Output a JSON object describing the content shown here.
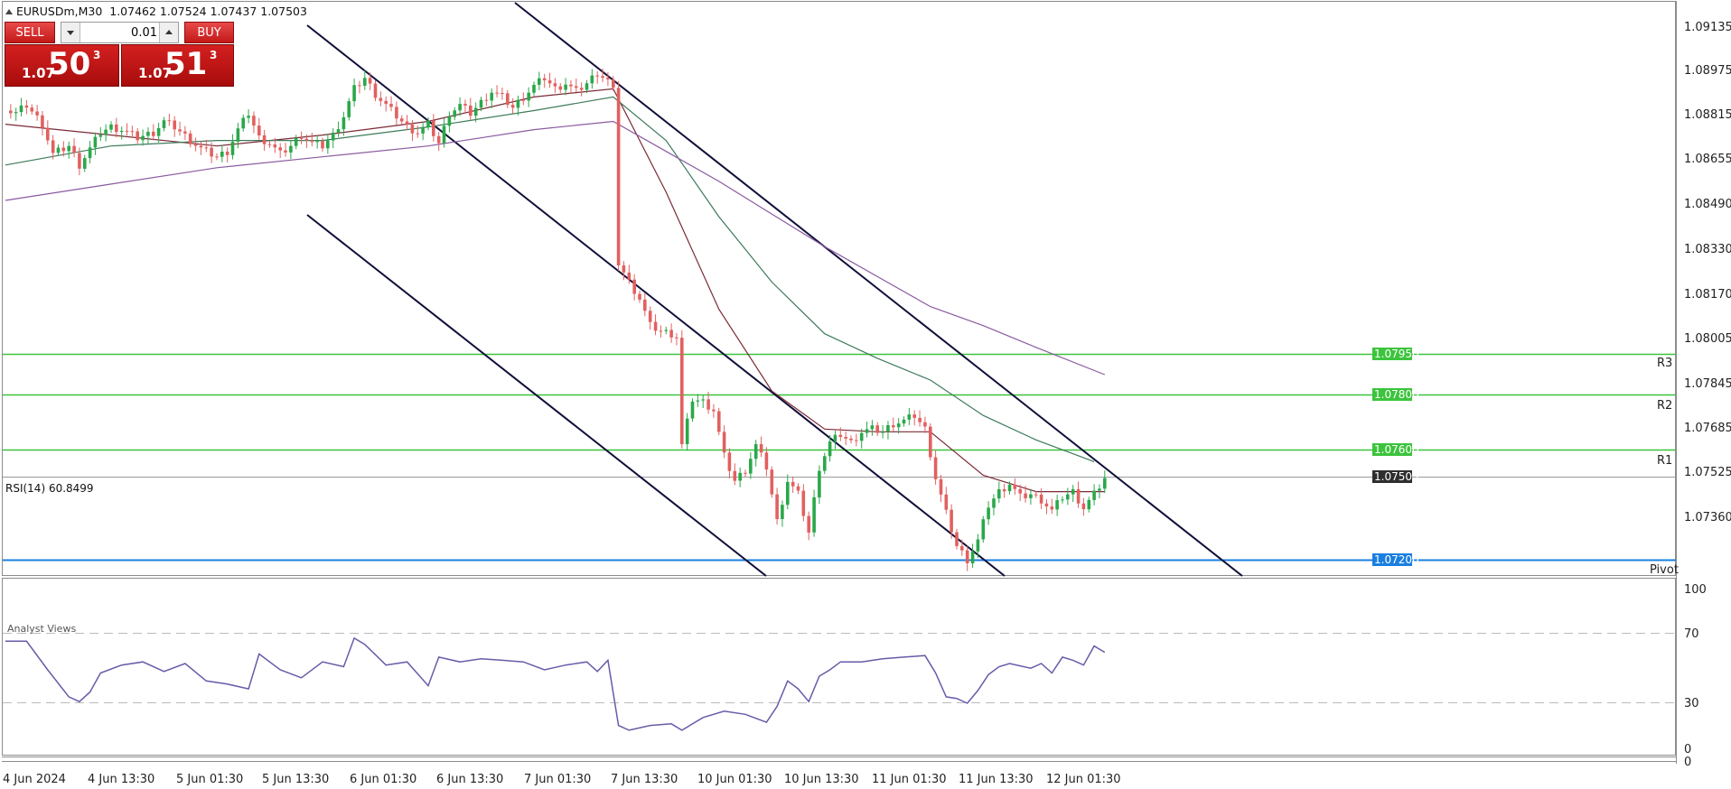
{
  "header": {
    "symbol_title": "EURUSDm,M30",
    "ohlc": "1.07462 1.07524 1.07437 1.07503"
  },
  "trade_panel": {
    "sell_label": "SELL",
    "buy_label": "BUY",
    "lot_value": "0.01",
    "sell_quote": {
      "prefix": "1.07",
      "big": "50",
      "sup": "3"
    },
    "buy_quote": {
      "prefix": "1.07",
      "big": "51",
      "sup": "3"
    }
  },
  "price_axis": {
    "ticks": [
      "1.09135",
      "1.08975",
      "1.08815",
      "1.08655",
      "1.08490",
      "1.08330",
      "1.08170",
      "1.08005",
      "1.07845",
      "1.07685",
      "1.07525",
      "1.07360"
    ],
    "tagged_levels": [
      {
        "label": "1.07950",
        "color": "#3cc43c",
        "kind": "R3"
      },
      {
        "label": "1.07800",
        "color": "#3cc43c",
        "kind": "R2"
      },
      {
        "label": "1.07600",
        "color": "#3cc43c",
        "kind": "R1"
      },
      {
        "label": "1.07503",
        "color": "#2e2e2e",
        "kind": "current"
      },
      {
        "label": "1.07200",
        "color": "#1a7fe0",
        "kind": "Pivot"
      }
    ],
    "level_markers": [
      "R3",
      "R2",
      "R1",
      "Pivot"
    ]
  },
  "rsi": {
    "label": "RSI(14) 60.8499",
    "ticks": [
      "100",
      "70",
      "30",
      "0"
    ]
  },
  "time_axis": {
    "labels": [
      "4 Jun 2024",
      "4 Jun 13:30",
      "5 Jun 01:30",
      "5 Jun 13:30",
      "6 Jun 01:30",
      "6 Jun 13:30",
      "7 Jun 01:30",
      "7 Jun 13:30",
      "10 Jun 01:30",
      "10 Jun 13:30",
      "11 Jun 01:30",
      "11 Jun 13:30",
      "12 Jun 01:30"
    ]
  },
  "bottom_panel": {
    "label": "Analyst Views",
    "scale_zero": "0"
  },
  "colors": {
    "bull": "#2aa84a",
    "bear": "#e26060",
    "ma_fast": "#7a2a36",
    "ma_mid": "#3e7a5a",
    "ma_slow": "#8a5aa0",
    "channel": "#10103a",
    "rsi": "#6a5aa8"
  },
  "chart_data": {
    "type": "candlestick",
    "price_range": [
      1.0716,
      1.0922
    ],
    "close_series": [
      [
        0,
        1.0885
      ],
      [
        2,
        1.0884
      ],
      [
        4,
        1.0887
      ],
      [
        7,
        1.088
      ],
      [
        9,
        1.0869
      ],
      [
        12,
        1.0872
      ],
      [
        14,
        1.0865
      ],
      [
        16,
        1.0871
      ],
      [
        18,
        1.0877
      ],
      [
        20,
        1.0879
      ],
      [
        22,
        1.0878
      ],
      [
        25,
        1.0875
      ],
      [
        28,
        1.0877
      ],
      [
        30,
        1.0881
      ],
      [
        32,
        1.0879
      ],
      [
        35,
        1.0874
      ],
      [
        37,
        1.0871
      ],
      [
        40,
        1.0868
      ],
      [
        42,
        1.087
      ],
      [
        44,
        1.0878
      ],
      [
        46,
        1.0884
      ],
      [
        48,
        1.0875
      ],
      [
        50,
        1.0873
      ],
      [
        52,
        1.0869
      ],
      [
        54,
        1.0872
      ],
      [
        56,
        1.0876
      ],
      [
        58,
        1.0873
      ],
      [
        60,
        1.0872
      ],
      [
        62,
        1.0876
      ],
      [
        64,
        1.0883
      ],
      [
        66,
        1.0893
      ],
      [
        68,
        1.0897
      ],
      [
        70,
        1.0891
      ],
      [
        72,
        1.0887
      ],
      [
        74,
        1.0883
      ],
      [
        76,
        1.0879
      ],
      [
        78,
        1.0877
      ],
      [
        80,
        1.088
      ],
      [
        82,
        1.0873
      ],
      [
        84,
        1.0884
      ],
      [
        86,
        1.0887
      ],
      [
        88,
        1.0884
      ],
      [
        90,
        1.0888
      ],
      [
        92,
        1.0892
      ],
      [
        94,
        1.089
      ],
      [
        96,
        1.0886
      ],
      [
        98,
        1.089
      ],
      [
        100,
        1.0894
      ],
      [
        102,
        1.0897
      ],
      [
        104,
        1.0893
      ],
      [
        106,
        1.0895
      ],
      [
        108,
        1.0892
      ],
      [
        110,
        1.0895
      ],
      [
        112,
        1.0899
      ],
      [
        114,
        1.0896
      ],
      [
        115,
        1.0892
      ],
      [
        116,
        1.0829
      ],
      [
        118,
        1.0822
      ],
      [
        120,
        1.0816
      ],
      [
        122,
        1.0806
      ],
      [
        124,
        1.0804
      ],
      [
        126,
        1.0803
      ],
      [
        127,
        1.0802
      ],
      [
        128,
        1.0762
      ],
      [
        130,
        1.0779
      ],
      [
        132,
        1.0778
      ],
      [
        134,
        1.0775
      ],
      [
        136,
        1.0758
      ],
      [
        138,
        1.0749
      ],
      [
        140,
        1.0753
      ],
      [
        142,
        1.0762
      ],
      [
        144,
        1.0754
      ],
      [
        146,
        1.0734
      ],
      [
        148,
        1.0749
      ],
      [
        150,
        1.0744
      ],
      [
        152,
        1.073
      ],
      [
        154,
        1.0754
      ],
      [
        156,
        1.0763
      ],
      [
        158,
        1.0766
      ],
      [
        160,
        1.0763
      ],
      [
        162,
        1.0767
      ],
      [
        164,
        1.0768
      ],
      [
        166,
        1.0767
      ],
      [
        168,
        1.077
      ],
      [
        170,
        1.0771
      ],
      [
        172,
        1.0773
      ],
      [
        174,
        1.0768
      ],
      [
        176,
        1.075
      ],
      [
        178,
        1.0737
      ],
      [
        180,
        1.0725
      ],
      [
        182,
        1.072
      ],
      [
        184,
        1.0727
      ],
      [
        186,
        1.074
      ],
      [
        188,
        1.0745
      ],
      [
        190,
        1.0748
      ],
      [
        192,
        1.0743
      ],
      [
        194,
        1.0744
      ],
      [
        196,
        1.0742
      ],
      [
        198,
        1.0738
      ],
      [
        200,
        1.0743
      ],
      [
        202,
        1.0745
      ],
      [
        204,
        1.0739
      ],
      [
        206,
        1.0744
      ],
      [
        208,
        1.075
      ]
    ],
    "moving_averages": [
      {
        "name": "ma_fast",
        "points": [
          [
            0,
            1.088
          ],
          [
            20,
            1.0876
          ],
          [
            40,
            1.0872
          ],
          [
            60,
            1.0876
          ],
          [
            80,
            1.0881
          ],
          [
            100,
            1.089
          ],
          [
            115,
            1.0893
          ],
          [
            125,
            1.0855
          ],
          [
            135,
            1.0812
          ],
          [
            145,
            1.0782
          ],
          [
            155,
            1.0768
          ],
          [
            165,
            1.0767
          ],
          [
            175,
            1.0767
          ],
          [
            185,
            1.0751
          ],
          [
            195,
            1.0745
          ],
          [
            208,
            1.0745
          ]
        ]
      },
      {
        "name": "ma_mid",
        "points": [
          [
            0,
            1.0865
          ],
          [
            20,
            1.0872
          ],
          [
            40,
            1.0874
          ],
          [
            60,
            1.0874
          ],
          [
            80,
            1.0879
          ],
          [
            100,
            1.0885
          ],
          [
            115,
            1.089
          ],
          [
            125,
            1.0874
          ],
          [
            135,
            1.0846
          ],
          [
            145,
            1.0822
          ],
          [
            155,
            1.0803
          ],
          [
            165,
            1.0794
          ],
          [
            175,
            1.0786
          ],
          [
            185,
            1.0773
          ],
          [
            195,
            1.0764
          ],
          [
            206,
            1.0756
          ]
        ]
      },
      {
        "name": "ma_slow",
        "points": [
          [
            0,
            1.0852
          ],
          [
            20,
            1.0858
          ],
          [
            40,
            1.0864
          ],
          [
            60,
            1.0868
          ],
          [
            80,
            1.0872
          ],
          [
            100,
            1.0878
          ],
          [
            115,
            1.0881
          ],
          [
            125,
            1.087
          ],
          [
            135,
            1.0859
          ],
          [
            145,
            1.0847
          ],
          [
            155,
            1.0835
          ],
          [
            165,
            1.0824
          ],
          [
            175,
            1.0813
          ],
          [
            185,
            1.0806
          ],
          [
            195,
            1.0798
          ],
          [
            208,
            1.0788
          ]
        ]
      }
    ],
    "rsi_series": [
      [
        0,
        68
      ],
      [
        4,
        68
      ],
      [
        8,
        50
      ],
      [
        12,
        33
      ],
      [
        14,
        30
      ],
      [
        16,
        36
      ],
      [
        18,
        48
      ],
      [
        22,
        53
      ],
      [
        26,
        55
      ],
      [
        30,
        49
      ],
      [
        34,
        54
      ],
      [
        38,
        43
      ],
      [
        42,
        41
      ],
      [
        46,
        38
      ],
      [
        48,
        60
      ],
      [
        52,
        50
      ],
      [
        56,
        45
      ],
      [
        60,
        55
      ],
      [
        64,
        52
      ],
      [
        66,
        70
      ],
      [
        68,
        66
      ],
      [
        72,
        53
      ],
      [
        76,
        55
      ],
      [
        80,
        40
      ],
      [
        82,
        58
      ],
      [
        86,
        55
      ],
      [
        90,
        57
      ],
      [
        94,
        56
      ],
      [
        98,
        55
      ],
      [
        102,
        50
      ],
      [
        106,
        53
      ],
      [
        110,
        55
      ],
      [
        112,
        49
      ],
      [
        114,
        56
      ],
      [
        116,
        15
      ],
      [
        118,
        12
      ],
      [
        122,
        15
      ],
      [
        126,
        16
      ],
      [
        128,
        12
      ],
      [
        132,
        20
      ],
      [
        136,
        24
      ],
      [
        140,
        22
      ],
      [
        144,
        17
      ],
      [
        146,
        27
      ],
      [
        148,
        43
      ],
      [
        150,
        38
      ],
      [
        152,
        30
      ],
      [
        154,
        46
      ],
      [
        156,
        50
      ],
      [
        158,
        55
      ],
      [
        162,
        55
      ],
      [
        166,
        57
      ],
      [
        170,
        58
      ],
      [
        174,
        59
      ],
      [
        176,
        48
      ],
      [
        178,
        33
      ],
      [
        180,
        32
      ],
      [
        182,
        29
      ],
      [
        184,
        37
      ],
      [
        186,
        47
      ],
      [
        188,
        52
      ],
      [
        190,
        54
      ],
      [
        194,
        51
      ],
      [
        196,
        54
      ],
      [
        198,
        48
      ],
      [
        200,
        58
      ],
      [
        202,
        56
      ],
      [
        204,
        53
      ],
      [
        206,
        65
      ],
      [
        208,
        61
      ]
    ],
    "rsi_levels": [
      70,
      30
    ],
    "horizontal_levels": [
      1.0795,
      1.078,
      1.076,
      1.07503,
      1.072
    ],
    "channel_lines": [
      {
        "from": [
          1.0916,
          1.0916
        ],
        "note": "descending trend channel"
      }
    ]
  }
}
